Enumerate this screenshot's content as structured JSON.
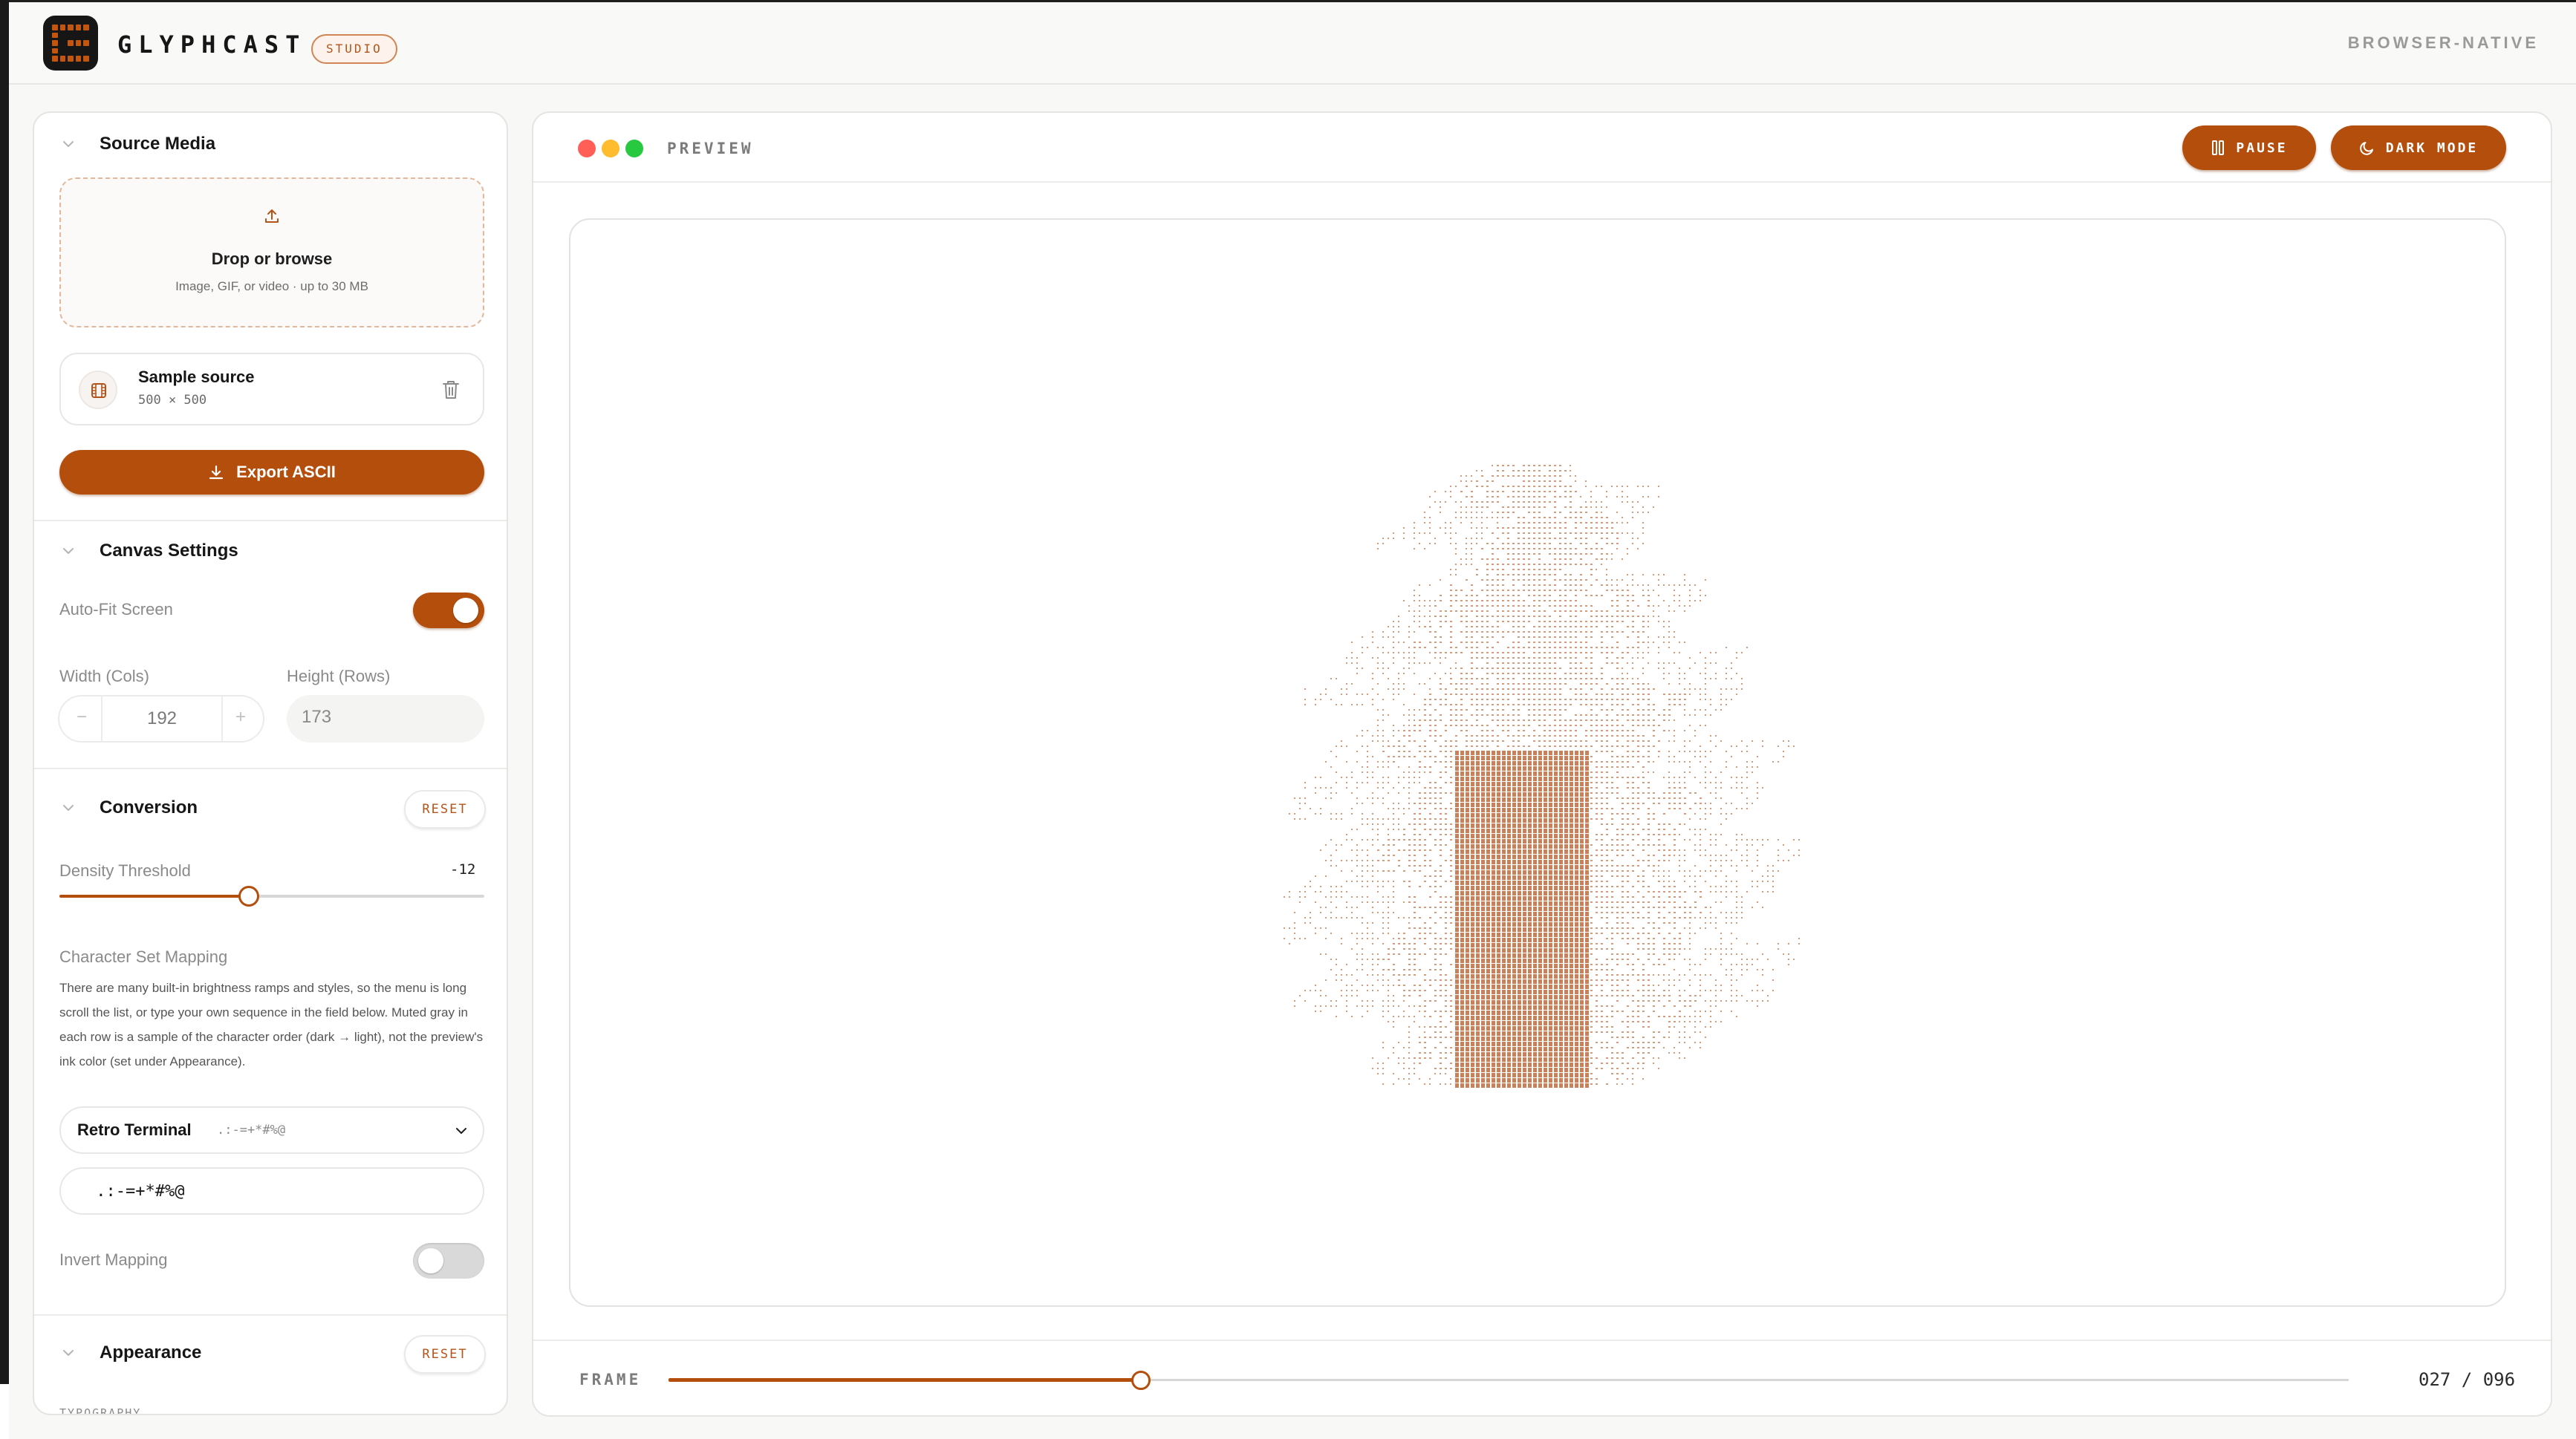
{
  "app": {
    "brand": "GLYPHCAST",
    "badge": "STUDIO",
    "mode_label": "BROWSER-NATIVE"
  },
  "icons": {
    "logo": "glyph-grid-logo",
    "section_toggle": "chevron-down-icon",
    "upload": "upload-icon",
    "source_thumb": "film-icon",
    "delete": "trash-icon",
    "export": "download-icon",
    "select_toggle": "chevron-down-icon",
    "pause": "pause-icon",
    "dark_mode": "moon-icon"
  },
  "colors": {
    "accent": "#b44e0d",
    "ascii_ink": "#c67a52",
    "window_close": "#ff5f57",
    "window_min": "#febc2e",
    "window_max": "#28c840"
  },
  "sidebar": {
    "source": {
      "title": "Source Media",
      "drop_title": "Drop or browse",
      "drop_hint": "Image, GIF, or video · up to 30 MB",
      "file_name": "Sample source",
      "file_dims": "500 × 500",
      "export_label": "Export ASCII"
    },
    "canvas": {
      "title": "Canvas Settings",
      "autofit_label": "Auto-Fit Screen",
      "autofit_on": true,
      "width_label": "Width (Cols)",
      "width_value": "192",
      "minus": "−",
      "plus": "+",
      "height_label": "Height (Rows)",
      "height_value": "173"
    },
    "conversion": {
      "title": "Conversion",
      "reset_label": "RESET",
      "density_label": "Density Threshold",
      "density_value": "-12",
      "density_fraction": 0.445,
      "charset_label": "Character Set Mapping",
      "charset_help": "There are many built-in brightness ramps and styles, so the menu is long scroll the list, or type your own sequence in the field below. Muted gray in each row is a sample of the character order (dark → light), not the preview's ink color (set under Appearance).",
      "charset_selected": "Retro Terminal",
      "charset_sample": " .:-=+*#%@",
      "charset_input": " .:-=+*#%@",
      "invert_label": "Invert Mapping",
      "invert_on": false
    },
    "appearance": {
      "title": "Appearance",
      "reset_label": "RESET",
      "sub_label": "TYPOGRAPHY"
    }
  },
  "preview": {
    "title": "PREVIEW",
    "pause_label": "PAUSE",
    "dark_mode_label": "DARK MODE",
    "frame_label": "FRAME",
    "frame_current": 27,
    "frame_total": 96,
    "frame_text": "027 / 096"
  }
}
